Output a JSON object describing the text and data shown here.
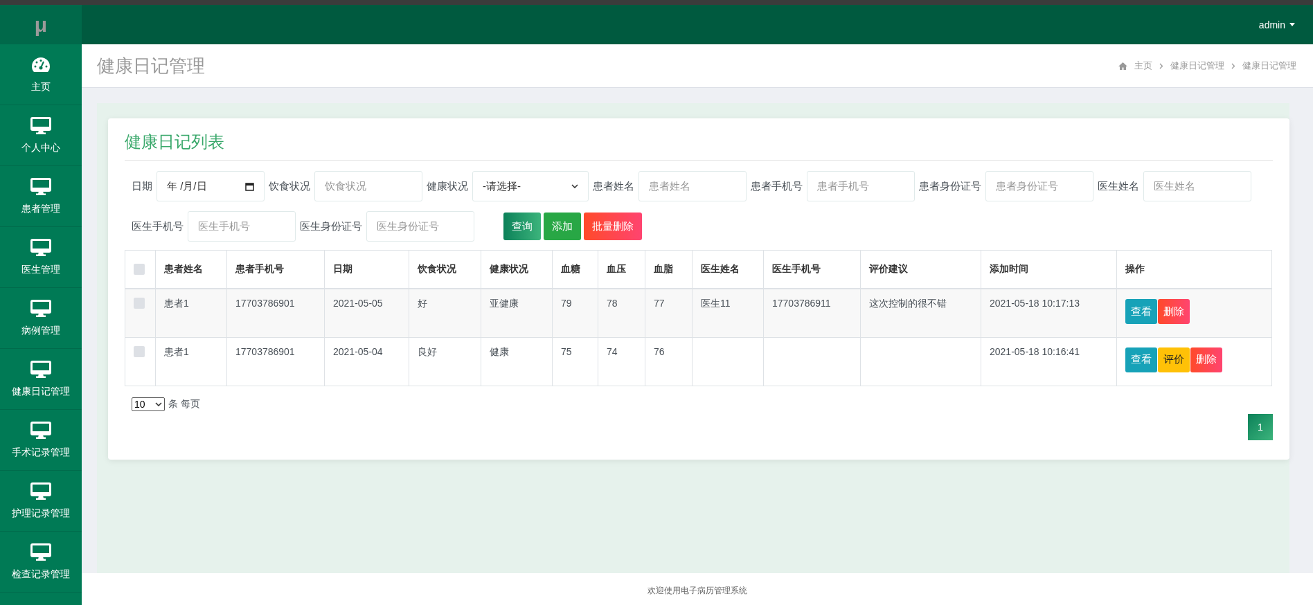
{
  "sidebar": {
    "logo": "μ",
    "items": [
      {
        "label": "主页",
        "kind": "dashboard"
      },
      {
        "label": "个人中心",
        "kind": "monitor"
      },
      {
        "label": "患者管理",
        "kind": "monitor"
      },
      {
        "label": "医生管理",
        "kind": "monitor"
      },
      {
        "label": "病例管理",
        "kind": "monitor"
      },
      {
        "label": "健康日记管理",
        "kind": "monitor"
      },
      {
        "label": "手术记录管理",
        "kind": "monitor"
      },
      {
        "label": "护理记录管理",
        "kind": "monitor"
      },
      {
        "label": "检查记录管理",
        "kind": "monitor"
      }
    ]
  },
  "topbar": {
    "user": "admin"
  },
  "page_header": {
    "title": "健康日记管理",
    "breadcrumb": [
      "主页",
      "健康日记管理",
      "健康日记管理"
    ]
  },
  "card": {
    "title": "健康日记列表",
    "filters": [
      {
        "label": "日期",
        "kind": "date",
        "value": "年 /月/日"
      },
      {
        "label": "饮食状况",
        "kind": "text",
        "placeholder": "饮食状况"
      },
      {
        "label": "健康状况",
        "kind": "select",
        "value": "-请选择-"
      },
      {
        "label": "患者姓名",
        "kind": "text",
        "placeholder": "患者姓名"
      },
      {
        "label": "患者手机号",
        "kind": "text",
        "placeholder": "患者手机号"
      },
      {
        "label": "患者身份证号",
        "kind": "text",
        "placeholder": "患者身份证号"
      },
      {
        "label": "医生姓名",
        "kind": "text",
        "placeholder": "医生姓名"
      },
      {
        "label": "医生手机号",
        "kind": "text",
        "placeholder": "医生手机号"
      },
      {
        "label": "医生身份证号",
        "kind": "text",
        "placeholder": "医生身份证号"
      }
    ],
    "buttons": [
      {
        "label": "查询",
        "kind": "search"
      },
      {
        "label": "添加",
        "kind": "add"
      },
      {
        "label": "批量删除",
        "kind": "delete"
      }
    ],
    "table": {
      "header_checked": false,
      "columns": [
        "患者姓名",
        "患者手机号",
        "日期",
        "饮食状况",
        "健康状况",
        "血糖",
        "血压",
        "血脂",
        "医生姓名",
        "医生手机号",
        "评价建议",
        "添加时间",
        "操作"
      ],
      "rows": [
        {
          "checked": false,
          "cells": [
            "患者1",
            "17703786901",
            "2021-05-05",
            "好",
            "亚健康",
            "79",
            "78",
            "77",
            "医生11",
            "17703786911",
            "这次控制的很不错",
            "2021-05-18 10:17:13"
          ],
          "actions": [
            {
              "label": "查看",
              "kind": "view"
            },
            {
              "label": "删除",
              "kind": "delete"
            }
          ]
        },
        {
          "checked": false,
          "cells": [
            "患者1",
            "17703786901",
            "2021-05-04",
            "良好",
            "健康",
            "75",
            "74",
            "76",
            "",
            "",
            "",
            "2021-05-18 10:16:41"
          ],
          "actions": [
            {
              "label": "查看",
              "kind": "view"
            },
            {
              "label": "评价",
              "kind": "review"
            },
            {
              "label": "删除",
              "kind": "delete"
            }
          ]
        }
      ]
    },
    "page_size": {
      "value": "10",
      "suffix": "条 每页"
    },
    "pagination": [
      {
        "label": "1",
        "selected": true
      }
    ]
  },
  "footer": "欢迎使用电子病历管理系统"
}
